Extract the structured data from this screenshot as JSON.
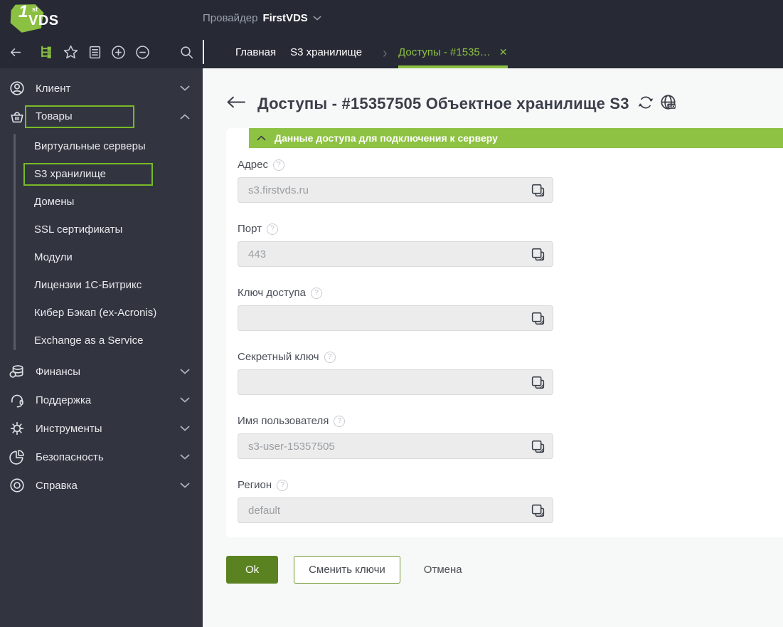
{
  "colors": {
    "accent": "#8cc042",
    "accent-dark": "#5a8221",
    "band-green": "#8dc242",
    "outline-green": "#79b928",
    "header-bg": "#272a35",
    "sidebar-bg": "#323540",
    "main-bg": "#f7f8f8",
    "panel-bg": "#ffffff",
    "input-bg": "#ececec",
    "input-border": "#d9d9d9",
    "input-text": "#9b9ea3",
    "text-dark": "#3b3f4a",
    "sidebar-text": "#e8e9ec",
    "muted": "#9aa0ad",
    "label": "#4a4e57",
    "cancel": "#4a4d52"
  },
  "ui": {
    "help_glyph": "?",
    "close_glyph": "✕"
  },
  "header": {
    "logo": {
      "one": "1",
      "sup": "st",
      "name": "VDS"
    },
    "provider_label": "Провайдер",
    "provider_name": "FirstVDS",
    "toolbar_icons": [
      "back-arrow",
      "tree-menu",
      "favorites-star",
      "tasks-clipboard",
      "zoom-in",
      "zoom-out",
      "search"
    ],
    "tabs": [
      {
        "label": "Главная",
        "active": false
      },
      {
        "label": "S3 хранилище",
        "active": false
      },
      {
        "label": "Доступы - #1535…",
        "active": true
      }
    ]
  },
  "sidebar": {
    "items": [
      {
        "label": "Клиент",
        "icon": "user-icon",
        "state": "collapsed"
      },
      {
        "label": "Товары",
        "icon": "basket-icon",
        "state": "expanded",
        "highlighted": true,
        "children": [
          "Виртуальные серверы",
          "S3 хранилище",
          "Домены",
          "SSL сертификаты",
          "Модули",
          "Лицензии 1С-Битрикс",
          "Кибер Бэкап (ex-Acronis)",
          "Exchange as a Service"
        ],
        "active_child": "S3 хранилище"
      },
      {
        "label": "Финансы",
        "icon": "finance-coins-icon",
        "state": "collapsed"
      },
      {
        "label": "Поддержка",
        "icon": "headset-icon",
        "state": "collapsed"
      },
      {
        "label": "Инструменты",
        "icon": "gear-icon",
        "state": "collapsed"
      },
      {
        "label": "Безопасность",
        "icon": "pie-chart-icon",
        "state": "collapsed"
      },
      {
        "label": "Справка",
        "icon": "help-ring-icon",
        "state": "collapsed"
      }
    ]
  },
  "main": {
    "title": "Доступы - #15357505 Объектное хранилище S3",
    "section_header": "Данные доступа для подключения к серверу",
    "fields": [
      {
        "label": "Адрес",
        "value": "s3.firstvds.ru",
        "redacted": false
      },
      {
        "label": "Порт",
        "value": "443",
        "redacted": false
      },
      {
        "label": "Ключ доступа",
        "value": "",
        "redacted": true
      },
      {
        "label": "Секретный ключ",
        "value": "",
        "redacted": true
      },
      {
        "label": "Имя пользователя",
        "value": "s3-user-15357505",
        "redacted": false
      },
      {
        "label": "Регион",
        "value": "default",
        "redacted": false
      }
    ],
    "buttons": {
      "ok": "Ok",
      "change_keys": "Сменить ключи",
      "cancel": "Отмена"
    }
  }
}
